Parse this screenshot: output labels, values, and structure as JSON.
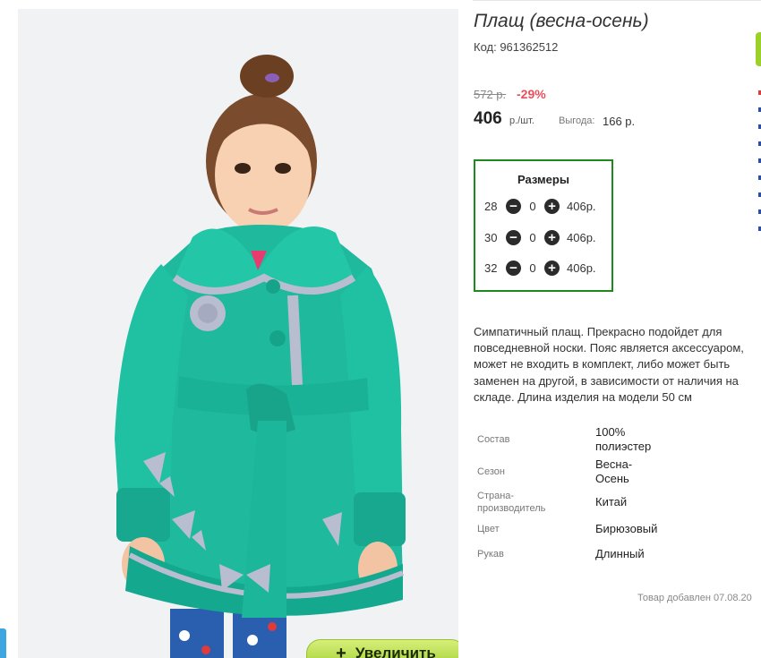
{
  "product": {
    "title": "Плащ (весна-осень)",
    "code": "Код: 961362512",
    "old_price": "572 р.",
    "discount": "-29%",
    "price": "406",
    "price_unit": "р./шт.",
    "benefit_label": "Выгода:",
    "benefit_value": "166 р."
  },
  "sizes": {
    "title": "Размеры",
    "rows": [
      {
        "size": "28",
        "qty": "0",
        "price": "406р."
      },
      {
        "size": "30",
        "qty": "0",
        "price": "406р."
      },
      {
        "size": "32",
        "qty": "0",
        "price": "406р."
      }
    ]
  },
  "description": [
    "Симпатичный плащ. Прекрасно подойдет для",
    "повседневной носки. Пояс является аксессуаром,",
    "может не входить в комплект, либо может быть",
    "заменен на другой, в зависимости от наличия на",
    "складе. Длина изделия на модели 50 см"
  ],
  "specs": [
    {
      "label": "Состав",
      "value": [
        "100%",
        "полиэстер"
      ]
    },
    {
      "label": "Сезон",
      "value": [
        "Весна-",
        "Осень"
      ]
    },
    {
      "label": [
        "Страна-",
        "производитель"
      ],
      "value": [
        "Китай"
      ]
    },
    {
      "label": "Цвет",
      "value": [
        "Бирюзовый"
      ]
    },
    {
      "label": "Рукав",
      "value": [
        "Длинный"
      ]
    }
  ],
  "added_text": "Товар добавлен 07.08.20",
  "zoom_button": {
    "icon": "plus-icon",
    "label": "Увеличить"
  },
  "colors": {
    "coat": "#1fb99e",
    "frill": "#b9bdd0",
    "sizes_border": "#1e8a1e",
    "discount": "#e8505b",
    "zoom_button": "#b5dc45"
  }
}
